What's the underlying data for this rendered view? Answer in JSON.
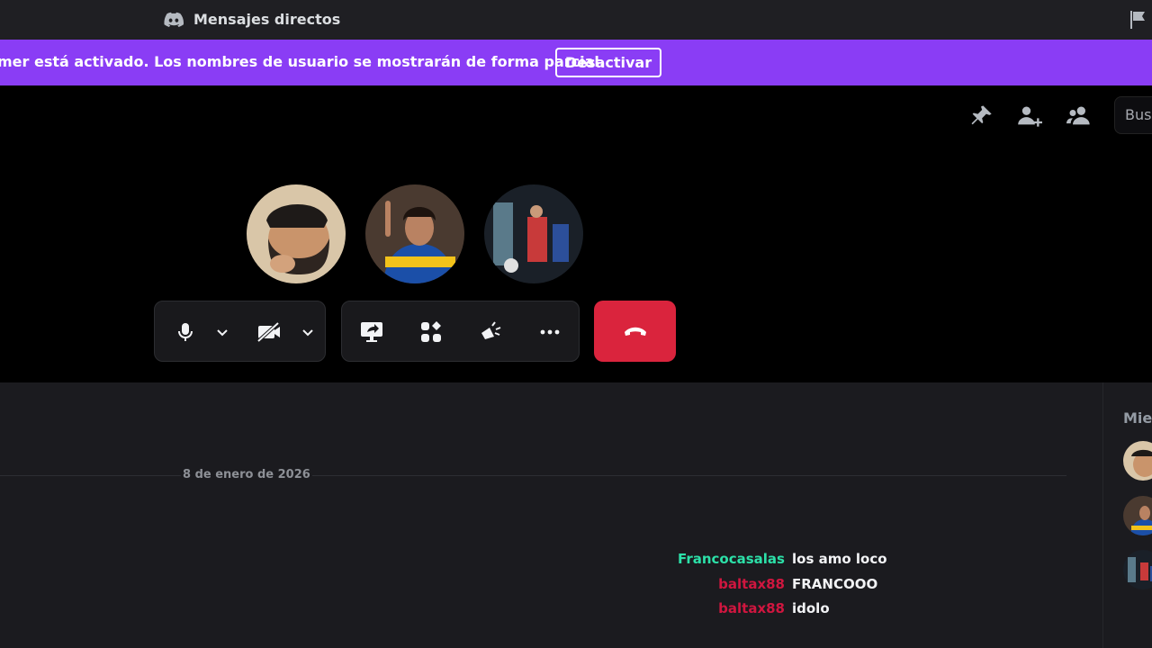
{
  "titlebar": {
    "title": "Mensajes directos"
  },
  "banner": {
    "text": "mer está activado. Los nombres de usuario se mostrarán de forma parcial.",
    "button_label": "Desactivar",
    "color": "#8a3df5"
  },
  "call": {
    "header_icons": [
      "pin-icon",
      "add-friend-icon",
      "members-icon"
    ],
    "search_placeholder": "Bus",
    "participants": [
      {
        "name": "participant-1",
        "colors": [
          "#d9b58e",
          "#3a2a22"
        ]
      },
      {
        "name": "participant-2",
        "colors": [
          "#1b4fa8",
          "#f2c21a"
        ]
      },
      {
        "name": "participant-3",
        "colors": [
          "#2b3440",
          "#c83a3a"
        ]
      }
    ],
    "controls": {
      "left": [
        "microphone-icon",
        "chevron-down-icon",
        "camera-off-icon",
        "chevron-down-icon"
      ],
      "middle": [
        "screen-share-icon",
        "activities-icon",
        "soundboard-icon",
        "more-icon"
      ],
      "hangup": "hang-up-icon",
      "hangup_color": "#da243d"
    }
  },
  "chat": {
    "date_divider": "8 de enero de 2026",
    "messages": [
      {
        "user": "Francocasalas",
        "color": "#2ce0a8",
        "text": "los amo loco"
      },
      {
        "user": "baltax88",
        "color": "#d0163f",
        "text": "FRANCOOO"
      },
      {
        "user": "baltax88",
        "color": "#d0163f",
        "text": "idolo"
      }
    ]
  },
  "members": {
    "header": "Mie"
  }
}
